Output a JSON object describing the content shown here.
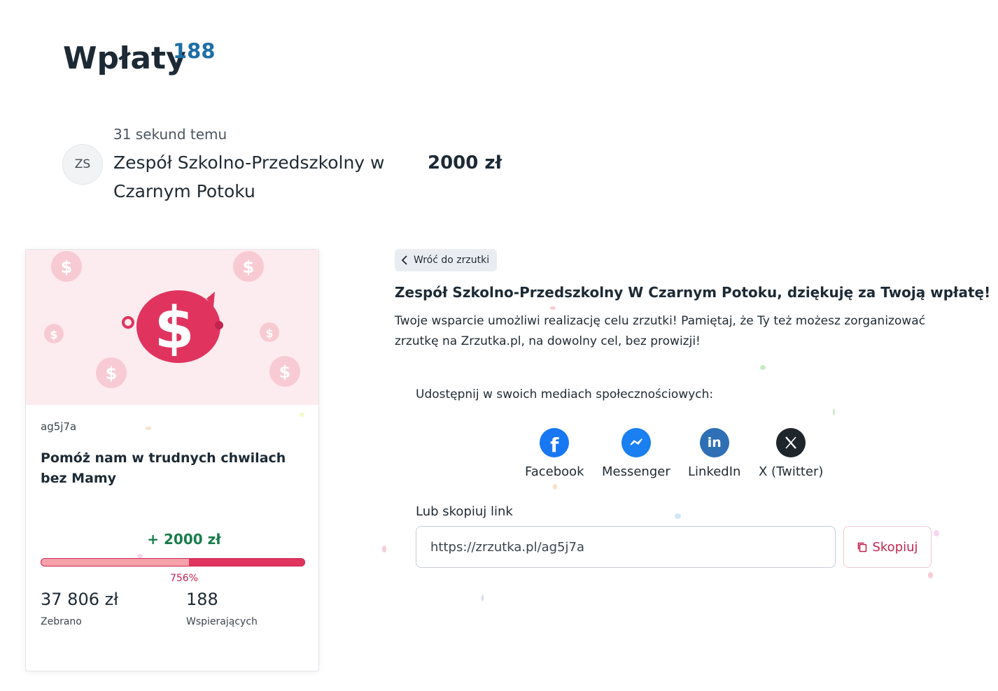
{
  "header": {
    "title": "Wpłaty",
    "count": "188"
  },
  "latest_donation": {
    "avatar_initials": "ZS",
    "time": "31 sekund temu",
    "name": "Zespół Szkolno-Przedszkolny w Czarnym Potoku",
    "amount": "2000 zł"
  },
  "campaign_card": {
    "code": "ag5j7a",
    "title": "Pomóż nam w trudnych chwilach bez Mamy",
    "added_amount": "+ 2000 zł",
    "progress_fraction": 0.56,
    "progress_label": "756%",
    "collected_value": "37 806 zł",
    "collected_label": "Zebrano",
    "supporters_value": "188",
    "supporters_label": "Wspierających",
    "colors": {
      "brand": "#e0345f",
      "fill_light": "#f7a1ab",
      "image_bg": "#fdecef",
      "plus_green": "#1a7d4c"
    }
  },
  "panel": {
    "back_label": "Wróć do zrzutki",
    "heading": "Zespół Szkolno-Przedszkolny W Czarnym Potoku, dziękuję za Twoją wpłatę!",
    "text": "Twoje wsparcie umożliwi realizację celu zrzutki! Pamiętaj, że Ty też możesz zorganizować zrzutkę na Zrzutka.pl, na dowolny cel, bez prowizji!",
    "share_label": "Udostępnij w swoich mediach społecznościowych:",
    "share_items": [
      {
        "label": "Facebook",
        "icon": "facebook-icon",
        "color": "#1877f2"
      },
      {
        "label": "Messenger",
        "icon": "messenger-icon",
        "color": "#1a7ff0"
      },
      {
        "label": "LinkedIn",
        "icon": "linkedin-icon",
        "color": "#2e6fb5"
      },
      {
        "label": "X (Twitter)",
        "icon": "x-icon",
        "color": "#1e252b"
      }
    ],
    "copy_label": "Lub skopiuj link",
    "link_value": "https://zrzutka.pl/ag5j7a",
    "copy_button": "Skopiuj"
  }
}
